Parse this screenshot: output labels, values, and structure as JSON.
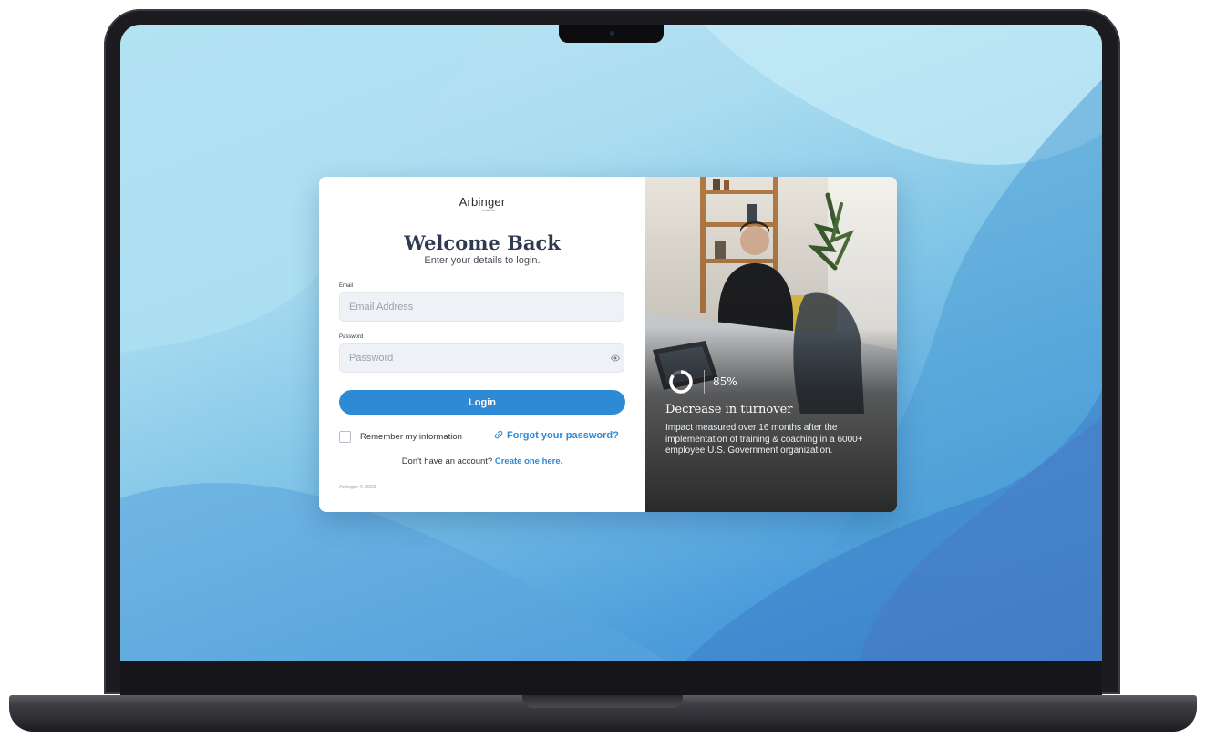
{
  "brand": {
    "name": "Arbinger",
    "sub": "Institute"
  },
  "login": {
    "heading": "Welcome Back",
    "subheading": "Enter your details to login.",
    "email_label": "Email",
    "email_placeholder": "Email Address",
    "password_label": "Password",
    "password_placeholder": "Password",
    "submit_label": "Login",
    "remember_label": "Remember my information",
    "remember_checked": false,
    "forgot_label": "Forgot your password?",
    "no_account_text": "Don't have an account?",
    "create_account_label": "Create one here.",
    "copyright": "Arbinger © 2023"
  },
  "stat": {
    "value": "85%",
    "progress": 0.85,
    "title": "Decrease in turnover",
    "description": "Impact measured over 16 months after the implementation of training & coaching in a 6000+ employee U.S. Government organization."
  },
  "icons": {
    "password_toggle": "eye-icon",
    "forgot": "link-icon",
    "stat": "progress-ring-icon"
  },
  "colors": {
    "accent": "#2f8ad6",
    "heading": "#2f3a52",
    "input_bg": "#eef1f6"
  }
}
